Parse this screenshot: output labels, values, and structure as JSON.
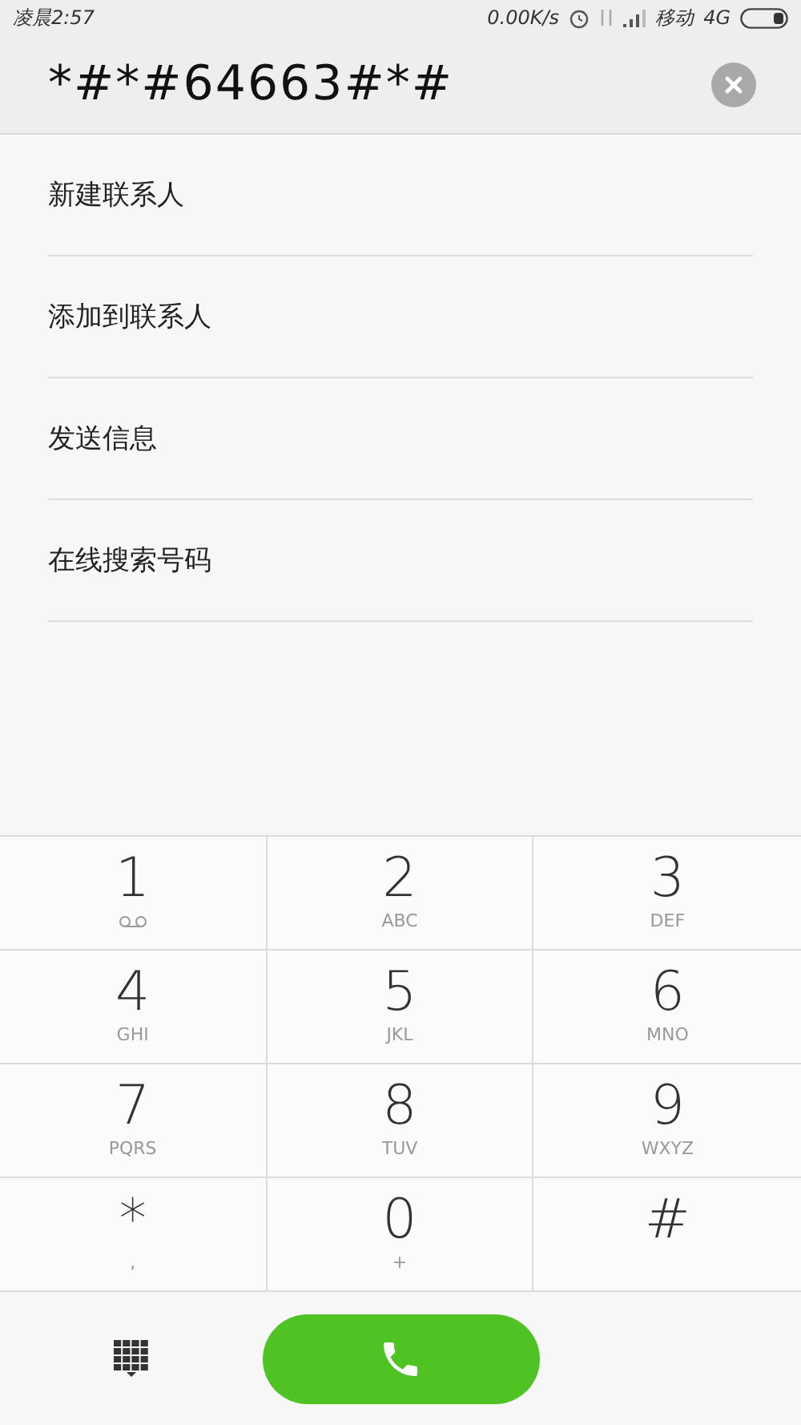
{
  "status_bar": {
    "time": "凌晨2:57",
    "speed": "0.00K/s",
    "carrier": "移动",
    "network": "4G"
  },
  "dial_field": {
    "value": "*#*#64663#*#"
  },
  "actions": [
    {
      "label": "新建联系人"
    },
    {
      "label": "添加到联系人"
    },
    {
      "label": "发送信息"
    },
    {
      "label": "在线搜索号码"
    }
  ],
  "keypad": [
    {
      "digit": "1",
      "kind": "voicemail"
    },
    {
      "digit": "2",
      "letters": "ABC",
      "kind": "letters"
    },
    {
      "digit": "3",
      "letters": "DEF",
      "kind": "letters"
    },
    {
      "digit": "4",
      "letters": "GHI",
      "kind": "letters"
    },
    {
      "digit": "5",
      "letters": "JKL",
      "kind": "letters"
    },
    {
      "digit": "6",
      "letters": "MNO",
      "kind": "letters"
    },
    {
      "digit": "7",
      "letters": "PQRS",
      "kind": "letters"
    },
    {
      "digit": "8",
      "letters": "TUV",
      "kind": "letters"
    },
    {
      "digit": "9",
      "letters": "WXYZ",
      "kind": "letters"
    },
    {
      "digit": "*",
      "letters": ",",
      "kind": "letters"
    },
    {
      "digit": "0",
      "letters": "+",
      "kind": "letters"
    },
    {
      "digit": "#",
      "kind": "plain"
    }
  ]
}
